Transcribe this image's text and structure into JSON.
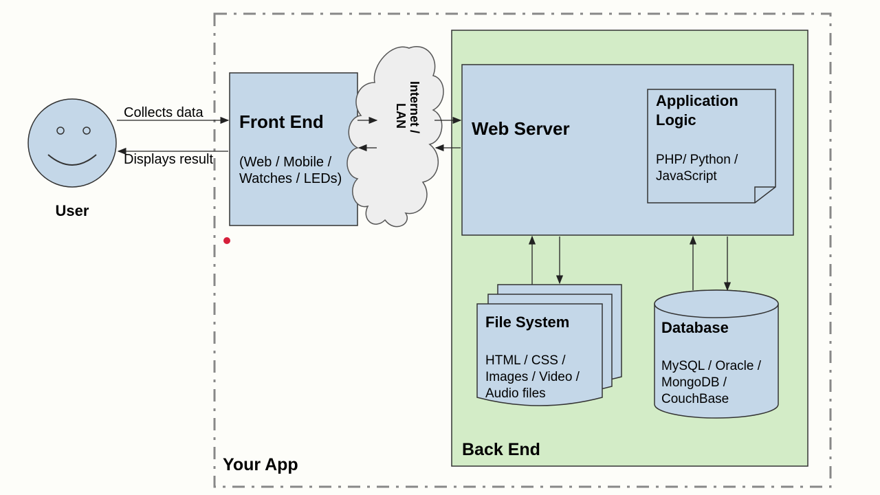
{
  "user": {
    "label": "User"
  },
  "arrows": {
    "collects": "Collects data",
    "displays": "Displays result"
  },
  "frontend": {
    "title": "Front End",
    "subtitle_line1": "(Web / Mobile /",
    "subtitle_line2": "Watches / LEDs)"
  },
  "cloud": {
    "label_line1": "Internet /",
    "label_line2": "LAN"
  },
  "backend": {
    "label": "Back End",
    "webserver": {
      "title": "Web Server"
    },
    "applogic": {
      "title_line1": "Application",
      "title_line2": "Logic",
      "body_line1": "PHP/ Python /",
      "body_line2": "JavaScript"
    },
    "filesystem": {
      "title": "File System",
      "body_line1": "HTML / CSS /",
      "body_line2": "Images / Video /",
      "body_line3": "Audio files"
    },
    "database": {
      "title": "Database",
      "body_line1": "MySQL / Oracle /",
      "body_line2": "MongoDB /",
      "body_line3": "CouchBase"
    }
  },
  "app_label": "Your App"
}
